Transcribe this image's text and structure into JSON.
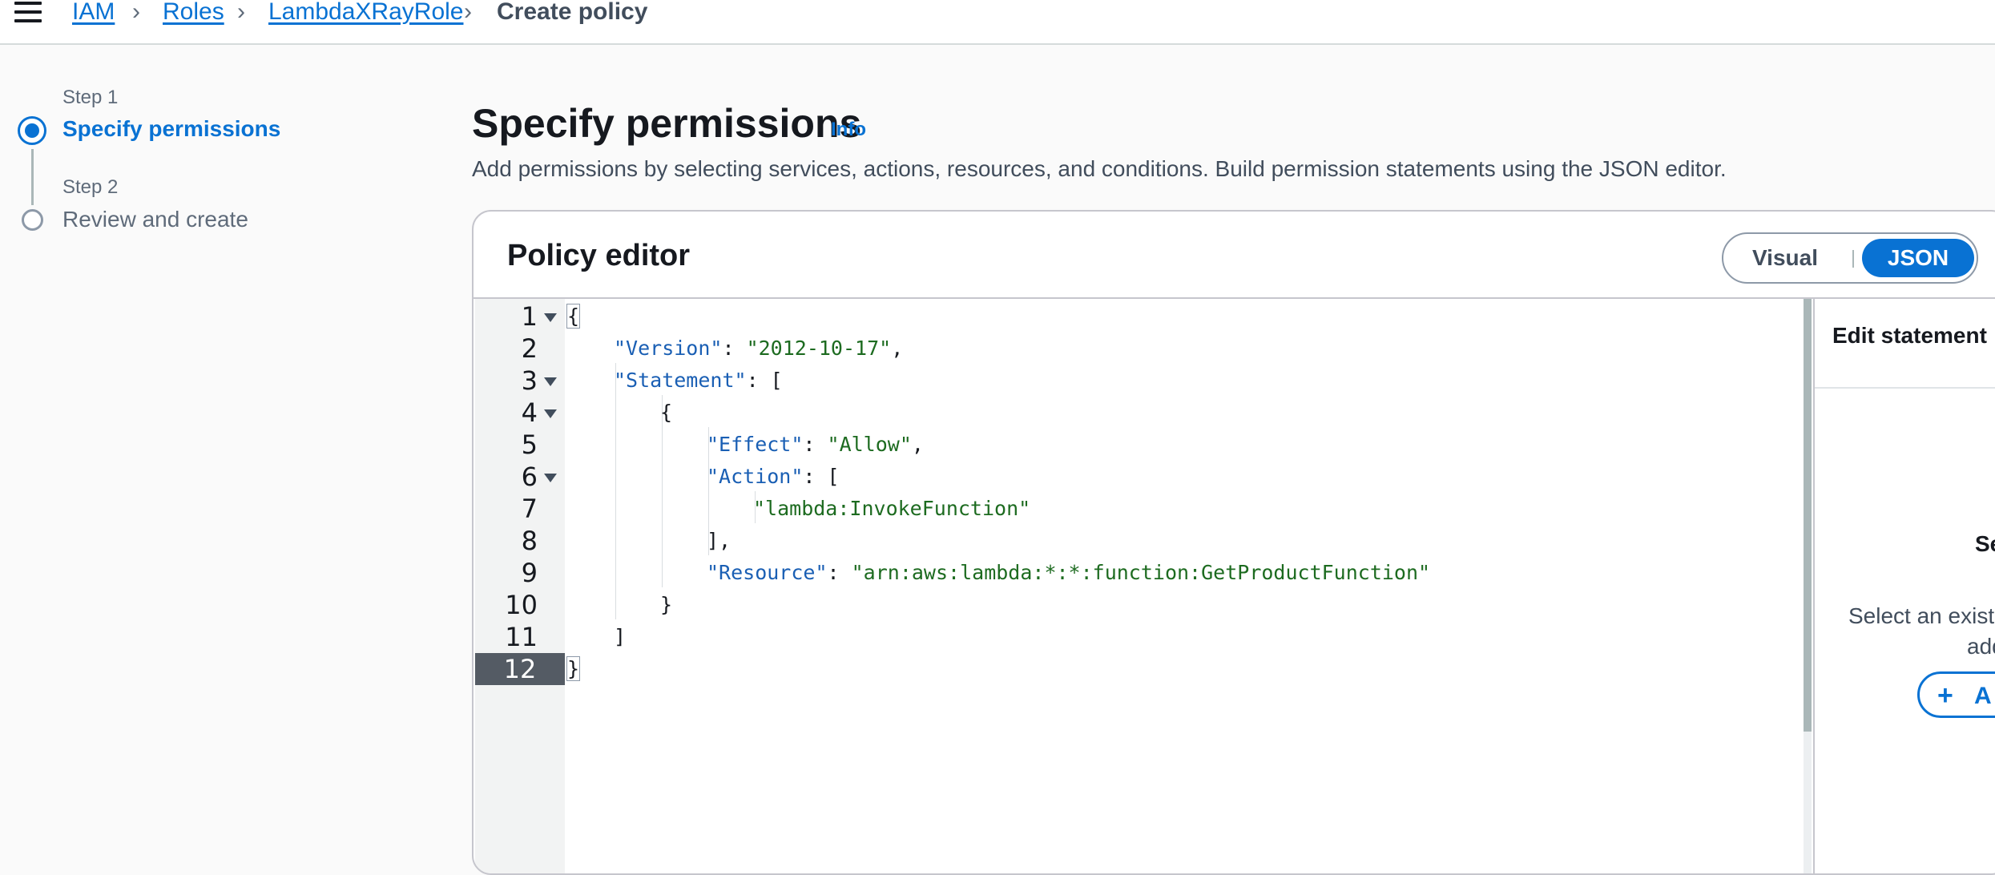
{
  "breadcrumb": {
    "items": [
      "IAM",
      "Roles",
      "LambdaXRayRole"
    ],
    "current": "Create policy"
  },
  "steps": [
    {
      "label": "Step 1",
      "title": "Specify permissions",
      "state": "active"
    },
    {
      "label": "Step 2",
      "title": "Review and create",
      "state": "inactive"
    }
  ],
  "page": {
    "title": "Specify permissions",
    "info": "Info",
    "description": "Add permissions by selecting services, actions, resources, and conditions. Build permission statements using the JSON editor."
  },
  "editor": {
    "title": "Policy editor",
    "modes": {
      "visual": "Visual",
      "json": "JSON",
      "selected": "JSON"
    },
    "line_numbers": [
      "1",
      "2",
      "3",
      "4",
      "5",
      "6",
      "7",
      "8",
      "9",
      "10",
      "11",
      "12"
    ],
    "active_line": "12",
    "lines": [
      {
        "key": "",
        "punct": "{",
        "str": "",
        "tail": ""
      },
      {
        "key": "\"Version\"",
        "punct": ": ",
        "str": "\"2012-10-17\"",
        "tail": ","
      },
      {
        "key": "\"Statement\"",
        "punct": ": [",
        "str": "",
        "tail": ""
      },
      {
        "key": "",
        "punct": "{",
        "str": "",
        "tail": ""
      },
      {
        "key": "\"Effect\"",
        "punct": ": ",
        "str": "\"Allow\"",
        "tail": ","
      },
      {
        "key": "\"Action\"",
        "punct": ": [",
        "str": "",
        "tail": ""
      },
      {
        "key": "",
        "punct": "",
        "str": "\"lambda:InvokeFunction\"",
        "tail": ""
      },
      {
        "key": "",
        "punct": "],",
        "str": "",
        "tail": ""
      },
      {
        "key": "\"Resource\"",
        "punct": ": ",
        "str": "\"arn:aws:lambda:*:*:function:GetProductFunction\"",
        "tail": ""
      },
      {
        "key": "",
        "punct": "}",
        "str": "",
        "tail": ""
      },
      {
        "key": "",
        "punct": "]",
        "str": "",
        "tail": ""
      },
      {
        "key": "",
        "punct": "}",
        "str": "",
        "tail": ""
      }
    ]
  },
  "side_panel": {
    "title": "Edit statement",
    "heading_partial": "Se",
    "text_line1": "Select an existi",
    "text_line2": "add",
    "button_partial": "A"
  },
  "colors": {
    "accent": "#0972d3",
    "json_key": "#1a5fb4",
    "json_string": "#1d6b20"
  }
}
